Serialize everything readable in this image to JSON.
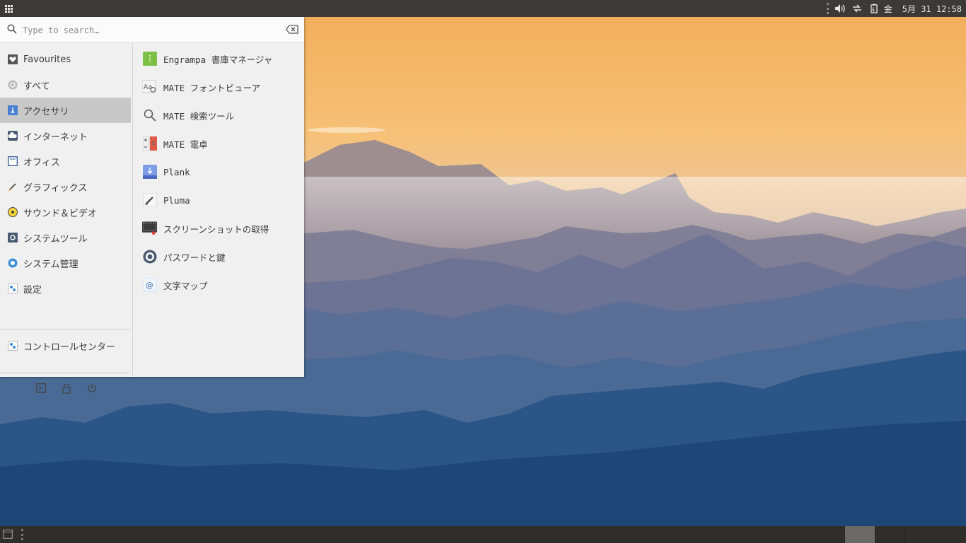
{
  "top_panel": {
    "input_indicator": "金",
    "clock": "5月 31 12:58"
  },
  "search": {
    "placeholder": "Type to search…",
    "value": ""
  },
  "categories": [
    {
      "label": "Favourites",
      "icon": "heart-icon",
      "active": false
    },
    {
      "label": "すべて",
      "icon": "all-apps-icon",
      "active": false
    },
    {
      "label": "アクセサリ",
      "icon": "accessories-icon",
      "active": true
    },
    {
      "label": "インターネット",
      "icon": "internet-icon",
      "active": false
    },
    {
      "label": "オフィス",
      "icon": "office-icon",
      "active": false
    },
    {
      "label": "グラフィックス",
      "icon": "graphics-icon",
      "active": false
    },
    {
      "label": "サウンド＆ビデオ",
      "icon": "sound-video-icon",
      "active": false
    },
    {
      "label": "システムツール",
      "icon": "system-tools-icon",
      "active": false
    },
    {
      "label": "システム管理",
      "icon": "administration-icon",
      "active": false
    },
    {
      "label": "設定",
      "icon": "preferences-icon",
      "active": false
    }
  ],
  "control_center": {
    "label": "コントロールセンター",
    "icon": "control-center-icon"
  },
  "apps": [
    {
      "label": "Engrampa 書庫マネージャ",
      "icon": "archive-manager-icon"
    },
    {
      "label": "MATE フォントビューア",
      "icon": "font-viewer-icon"
    },
    {
      "label": "MATE 検索ツール",
      "icon": "search-tool-icon"
    },
    {
      "label": "MATE 電卓",
      "icon": "calculator-icon"
    },
    {
      "label": "Plank",
      "icon": "plank-dock-icon"
    },
    {
      "label": "Pluma",
      "icon": "text-editor-icon"
    },
    {
      "label": "スクリーンショットの取得",
      "icon": "screenshot-icon"
    },
    {
      "label": "パスワードと鍵",
      "icon": "passwords-keys-icon"
    },
    {
      "label": "文字マップ",
      "icon": "character-map-icon"
    }
  ],
  "colors": {
    "panel": "#3c3a36",
    "menu_bg": "#f0f0f0",
    "active_category": "#c8c8c8",
    "sky_top": "#f3b461",
    "mountain_dark": "#1d3f68"
  }
}
